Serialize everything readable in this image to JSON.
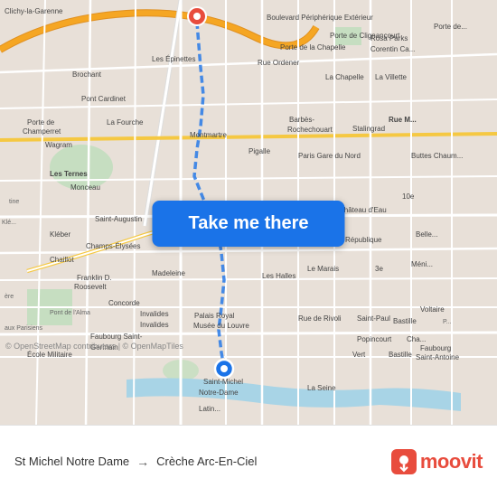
{
  "map": {
    "button_label": "Take me there",
    "copyright": "© OpenStreetMap contributors | © OpenMapTiles",
    "bg_color": "#e8e0d8"
  },
  "bottom_bar": {
    "origin": "St Michel Notre Dame",
    "arrow": "→",
    "destination": "Crèche Arc-En-Ciel",
    "logo_text": "moovit"
  },
  "pin_origin": {
    "color": "#1a73e8",
    "label": "origin"
  },
  "pin_destination": {
    "color": "#e84c3d",
    "label": "destination"
  }
}
